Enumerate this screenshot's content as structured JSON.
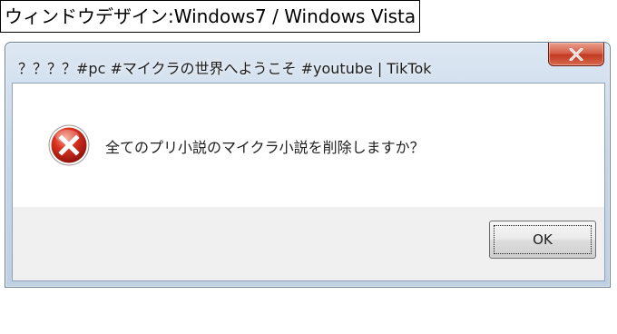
{
  "caption": "ウィンドウデザイン:Windows7 / Windows Vista",
  "window": {
    "title": "？？？？#pc #マイクラの世界へようこそ #youtube | TikTok",
    "close_icon": "close-x-icon",
    "chrome_color": "#c6d6e8",
    "close_color": "#c9432c"
  },
  "dialog": {
    "icon": "error-icon",
    "message": "全てのプリ小説のマイクラ小説を削除しますか？",
    "buttons": {
      "ok_label": "OK"
    }
  }
}
